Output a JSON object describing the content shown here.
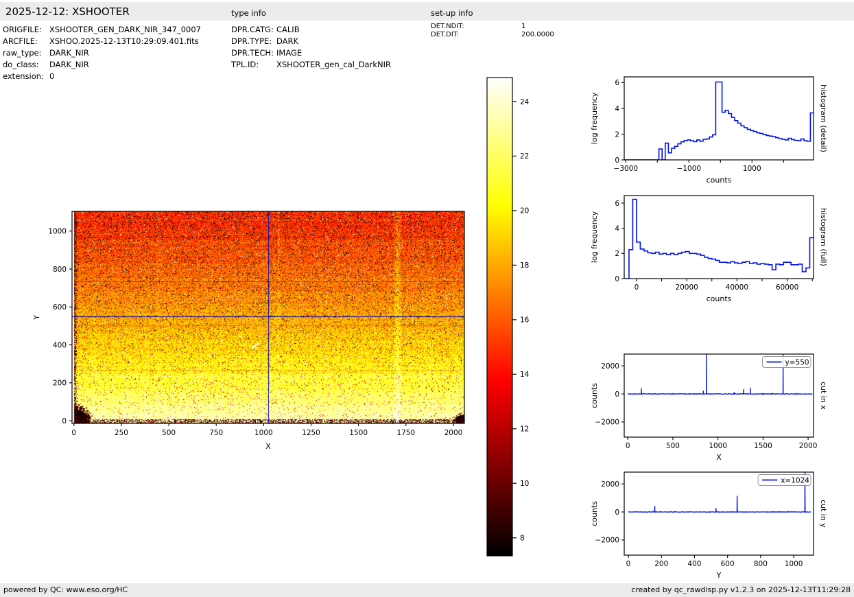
{
  "header": {
    "title": "2025-12-12: XSHOOTER",
    "type_info_label": "type info",
    "setup_info_label": "set-up info"
  },
  "metadata": {
    "file_info": [
      {
        "label": "ORIGFILE:",
        "value": "XSHOOTER_GEN_DARK_NIR_347_0007"
      },
      {
        "label": "ARCFILE:",
        "value": "XSHOO.2025-12-13T10:29:09.401.fits"
      },
      {
        "label": "raw_type:",
        "value": "DARK_NIR"
      },
      {
        "label": "do_class:",
        "value": "DARK_NIR"
      },
      {
        "label": "extension:",
        "value": "0"
      }
    ],
    "type_info": [
      {
        "label": "DPR.CATG:",
        "value": "CALIB"
      },
      {
        "label": "DPR.TYPE:",
        "value": "DARK"
      },
      {
        "label": "DPR.TECH:",
        "value": "IMAGE"
      },
      {
        "label": "TPL.ID:",
        "value": "XSHOOTER_gen_cal_DarkNIR"
      }
    ],
    "setup_info": [
      {
        "label": "DET.NDIT:",
        "value": "1"
      },
      {
        "label": "DET.DIT:",
        "value": "200.0000"
      }
    ]
  },
  "footer": {
    "left": "powered by QC: www.eso.org/HC",
    "right": "created by qc_rawdisp.py v1.2.3 on 2025-12-13T11:29:28"
  },
  "colors": {
    "plot_line_blue": "#0010ee",
    "crosshair_blue": "#0000bb",
    "bar_background": "#ececec",
    "axis_black": "#000000",
    "legend_border": "#999999"
  },
  "chart_data": [
    {
      "id": "detector_image",
      "type": "heatmap",
      "title": "",
      "xlabel": "X",
      "ylabel": "Y",
      "xlim": [
        -10,
        2058
      ],
      "ylim": [
        -14,
        1104
      ],
      "xticks": [
        0,
        250,
        500,
        750,
        1000,
        1250,
        1500,
        1750,
        2000
      ],
      "yticks": [
        0,
        200,
        400,
        600,
        800,
        1000
      ],
      "colormap": "hot",
      "vmin": 7.35,
      "vmax": 24.9,
      "colorbar": {
        "ticks": [
          24,
          22,
          20,
          18,
          16,
          14,
          12,
          10,
          8
        ],
        "top_value": 24.88,
        "bottom_value": 7.34
      },
      "crosshair": {
        "x": 1024,
        "y": 550
      },
      "gradient": {
        "v_bottom": 22.8,
        "v_top": 15.0,
        "gamma": 1.35,
        "bottom_band_height": 215,
        "bottom_band_boost": 0.9
      },
      "features": {
        "white_row_y": 231,
        "faint_bright_row_y": 205,
        "dark_rows_y": [
          268,
          500,
          732,
          964
        ],
        "bright_columns": [
          {
            "x": 1706,
            "halfwidth": 22,
            "boost": 1.3
          },
          {
            "x": 1078,
            "halfwidth": 10,
            "boost": 0.7
          }
        ],
        "black_corner_bottom_left_radius": 95,
        "black_corner_bottom_right_radius": 38,
        "dark_left_edge_width": 20,
        "bright_blob": {
          "x": 955,
          "y": 395
        }
      },
      "description": "XSHOOTER NIR raw dark frame: bright yellow-white at bottom rows fading to dark red at top, black vignetted bottom corners, white stripe near y=231, bright column near x=1706, blue crosshair at x=1024 / y=550"
    },
    {
      "id": "histogram_detail",
      "type": "step-histogram",
      "right_label": "histogram (detail)",
      "xlabel": "counts",
      "ylabel": "log frequency",
      "xlim": [
        -3050,
        2950
      ],
      "ylim": [
        0,
        6.45
      ],
      "xticks_major": [
        -3000,
        -1000,
        1000
      ],
      "xticks_minor": [
        -2000,
        0,
        2000
      ],
      "yticks": [
        0,
        2,
        4,
        6
      ],
      "bin_start": -3050,
      "bin_width": 100,
      "values": [
        0,
        0,
        0,
        0,
        0,
        0,
        0,
        0,
        0,
        0,
        0,
        0.85,
        0,
        1.3,
        0.55,
        0.9,
        1.05,
        1.25,
        1.4,
        1.5,
        1.55,
        1.48,
        1.42,
        1.55,
        1.45,
        1.6,
        1.62,
        1.78,
        1.95,
        6.05,
        6.05,
        3.7,
        3.85,
        3.6,
        3.3,
        3.05,
        2.85,
        2.65,
        2.5,
        2.38,
        2.28,
        2.2,
        2.1,
        2.05,
        1.98,
        1.9,
        1.85,
        1.8,
        1.72,
        1.65,
        1.6,
        1.55,
        1.68,
        1.58,
        1.52,
        1.5,
        1.62,
        1.48,
        1.45,
        3.65
      ]
    },
    {
      "id": "histogram_full",
      "type": "step-histogram",
      "right_label": "histogram (full)",
      "xlabel": "counts",
      "ylabel": "log frequency",
      "xlim": [
        -4900,
        70500
      ],
      "ylim": [
        0,
        6.6
      ],
      "xticks_major": [
        0,
        20000,
        40000,
        60000
      ],
      "xticks_minor": [
        10000,
        30000,
        50000,
        70000
      ],
      "yticks": [
        0,
        2,
        4,
        6
      ],
      "bin_start": -4500,
      "bin_width": 1500,
      "values": [
        0,
        2.3,
        6.3,
        2.9,
        2.35,
        2.2,
        2.05,
        2.0,
        2.1,
        1.95,
        2.0,
        1.9,
        2.0,
        1.9,
        2.0,
        2.1,
        2.15,
        2.0,
        2.0,
        1.95,
        1.85,
        1.7,
        1.6,
        1.55,
        1.45,
        1.3,
        1.3,
        1.25,
        1.35,
        1.25,
        1.2,
        1.3,
        1.35,
        1.2,
        1.25,
        1.15,
        1.2,
        1.15,
        1.1,
        0.7,
        1.15,
        1.1,
        1.3,
        1.3,
        1.1,
        1.1,
        1.15,
        0.55,
        0.85,
        3.25
      ]
    },
    {
      "id": "cut_in_x",
      "type": "line",
      "right_label": "cut in x",
      "legend_label": "y=550",
      "xlabel": "X",
      "ylabel": "counts",
      "xlim": [
        -40,
        2060
      ],
      "ylim": [
        -3080,
        2840
      ],
      "data_range": [
        0,
        2048
      ],
      "xticks_major": [
        0,
        500,
        1000,
        1500,
        2000
      ],
      "yticks": [
        -2000,
        0,
        2000
      ],
      "baseline_noise": 28,
      "spikes": [
        {
          "x": 150,
          "y": 400
        },
        {
          "x": 838,
          "y": 230
        },
        {
          "x": 872,
          "y": 3400
        },
        {
          "x": 1180,
          "y": 130
        },
        {
          "x": 1285,
          "y": 340
        },
        {
          "x": 1360,
          "y": 440
        },
        {
          "x": 1500,
          "y": -90
        },
        {
          "x": 1722,
          "y": 2950
        }
      ]
    },
    {
      "id": "cut_in_y",
      "type": "line",
      "right_label": "cut in y",
      "legend_label": "x=1024",
      "xlabel": "Y",
      "ylabel": "counts",
      "xlim": [
        -25,
        1120
      ],
      "ylim": [
        -3080,
        2840
      ],
      "data_range": [
        0,
        1104
      ],
      "xticks_major": [
        0,
        200,
        400,
        600,
        800,
        1000
      ],
      "yticks": [
        -2000,
        0,
        2000
      ],
      "baseline_noise": 24,
      "spikes": [
        {
          "x": 160,
          "y": 420
        },
        {
          "x": 530,
          "y": 280
        },
        {
          "x": 658,
          "y": 1150
        },
        {
          "x": 1068,
          "y": 3000
        }
      ]
    }
  ]
}
